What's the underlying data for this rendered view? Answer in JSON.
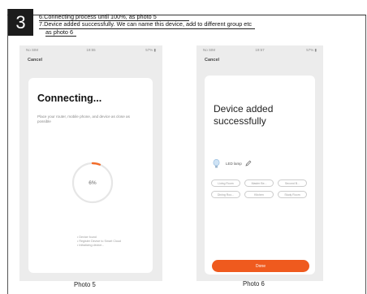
{
  "step": {
    "number": "3",
    "line1": "6.Connecting process until 100%,  as photo 5",
    "line2": "7.Device added successfully. We can name this device, add to different group etc",
    "line3": "as photo 6"
  },
  "photo5": {
    "status_left": "No SIM",
    "status_center": "19:55",
    "status_right": "57% ▮",
    "cancel": "Cancel",
    "title": "Connecting...",
    "description": "Place your router, mobile phone, and device as close as possible",
    "progress_percent": 6,
    "progress_label": "6%",
    "steps": [
      "Device found",
      "Register Device to Smart Cloud",
      "Initializing device..."
    ],
    "caption": "Photo 5",
    "accent": "#f26c2a"
  },
  "photo6": {
    "status_left": "No SIM",
    "status_center": "19:57",
    "status_right": "57% ▮",
    "cancel": "Cancel",
    "title_line1": "Device added",
    "title_line2": "successfully",
    "device_name": "LED lamp",
    "rooms": [
      "Living Room",
      "Master Be...",
      "Second B...",
      "Dining Roo...",
      "Kitchen",
      "Study Room"
    ],
    "done": "Done",
    "caption": "Photo 6",
    "accent": "#ef5a1e"
  }
}
